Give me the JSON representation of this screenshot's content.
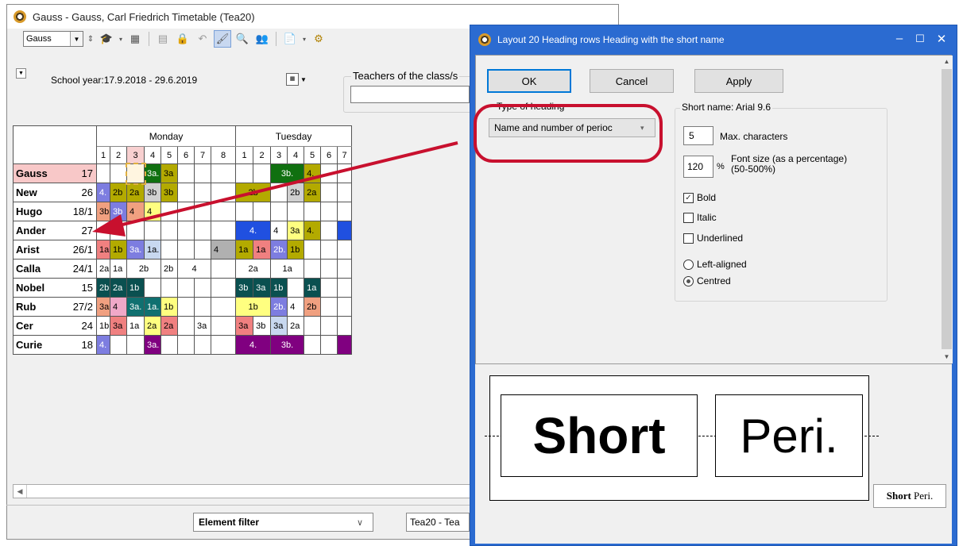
{
  "main_window": {
    "title": "Gauss - Gauss, Carl Friedrich  Timetable  (Tea20)",
    "element_select": "Gauss"
  },
  "info": {
    "school_year": "School year:17.9.2018 - 29.6.2019",
    "teachers_label": "Teachers of the class/s"
  },
  "timetable": {
    "days": [
      "Monday",
      "Tuesday"
    ],
    "periods": [
      "1",
      "2",
      "3",
      "4",
      "5",
      "6",
      "7",
      "8",
      "1",
      "2",
      "3",
      "4",
      "5",
      "6",
      "7"
    ],
    "rows": [
      {
        "name": "Gauss",
        "num": "17",
        "cells": [
          {
            "t": "",
            "s": 1,
            "c": "#ffffff"
          },
          {
            "t": "",
            "s": 1,
            "c": "#ffffff"
          },
          {
            "t": "",
            "s": 1,
            "c": "#fff5e0"
          },
          {
            "t": "3a.",
            "s": 1,
            "c": "#107010",
            "w": true
          },
          {
            "t": "3a",
            "s": 1,
            "c": "#b3aa00"
          },
          {
            "t": "",
            "s": 1,
            "c": "#ffffff"
          },
          {
            "t": "",
            "s": 1,
            "c": "#ffffff"
          },
          {
            "t": "",
            "s": 1,
            "c": "#ffffff"
          },
          {
            "t": "",
            "s": 1,
            "c": "#ffffff"
          },
          {
            "t": "",
            "s": 1,
            "c": "#ffffff"
          },
          {
            "t": "3b.",
            "s": 2,
            "c": "#107010",
            "w": true
          },
          {
            "t": "4.",
            "s": 1,
            "c": "#b3aa00"
          },
          {
            "t": "",
            "s": 1,
            "c": "#ffffff"
          },
          {
            "t": "",
            "s": 1,
            "c": "#ffffff"
          }
        ]
      },
      {
        "name": "New",
        "num": "26",
        "cells": [
          {
            "t": "4.",
            "s": 1,
            "c": "#7d7de0",
            "w": true
          },
          {
            "t": "2b",
            "s": 1,
            "c": "#b3aa00"
          },
          {
            "t": "2a",
            "s": 1,
            "c": "#b3aa00"
          },
          {
            "t": "3b",
            "s": 1,
            "c": "#d0d0d0"
          },
          {
            "t": "3b",
            "s": 1,
            "c": "#b3aa00"
          },
          {
            "t": "",
            "s": 1,
            "c": "#ffffff"
          },
          {
            "t": "",
            "s": 1,
            "c": "#ffffff"
          },
          {
            "t": "",
            "s": 1,
            "c": "#ffffff"
          },
          {
            "t": "2b",
            "s": 2,
            "c": "#b3aa00"
          },
          {
            "t": "",
            "s": 1,
            "c": "#ffffff"
          },
          {
            "t": "2b",
            "s": 1,
            "c": "#d0d0d0"
          },
          {
            "t": "2a",
            "s": 1,
            "c": "#b3aa00"
          },
          {
            "t": "",
            "s": 1,
            "c": "#ffffff"
          },
          {
            "t": "",
            "s": 1,
            "c": "#ffffff"
          }
        ]
      },
      {
        "name": "Hugo",
        "num": "18/1",
        "cells": [
          {
            "t": "3b",
            "s": 1,
            "c": "#f0a080"
          },
          {
            "t": "3b",
            "s": 1,
            "c": "#7d7de0",
            "w": true
          },
          {
            "t": "4",
            "s": 1,
            "c": "#f0a080"
          },
          {
            "t": "4",
            "s": 1,
            "c": "#ffff80"
          },
          {
            "t": "",
            "s": 1,
            "c": "#ffffff"
          },
          {
            "t": "",
            "s": 1,
            "c": "#ffffff"
          },
          {
            "t": "",
            "s": 1,
            "c": "#ffffff"
          },
          {
            "t": "",
            "s": 1,
            "c": "#ffffff"
          },
          {
            "t": "",
            "s": 1,
            "c": "#ffffff"
          },
          {
            "t": "",
            "s": 1,
            "c": "#ffffff"
          },
          {
            "t": "",
            "s": 1,
            "c": "#ffffff"
          },
          {
            "t": "",
            "s": 1,
            "c": "#ffffff"
          },
          {
            "t": "",
            "s": 1,
            "c": "#ffffff"
          },
          {
            "t": "",
            "s": 1,
            "c": "#ffffff"
          },
          {
            "t": "",
            "s": 1,
            "c": "#ffffff"
          }
        ]
      },
      {
        "name": "Ander",
        "num": "27",
        "cells": [
          {
            "t": "",
            "s": 1,
            "c": "#ffffff"
          },
          {
            "t": "",
            "s": 1,
            "c": "#ffffff"
          },
          {
            "t": "",
            "s": 1,
            "c": "#ffffff"
          },
          {
            "t": "",
            "s": 1,
            "c": "#ffffff"
          },
          {
            "t": "",
            "s": 1,
            "c": "#ffffff"
          },
          {
            "t": "",
            "s": 1,
            "c": "#ffffff"
          },
          {
            "t": "",
            "s": 1,
            "c": "#ffffff"
          },
          {
            "t": "",
            "s": 1,
            "c": "#ffffff"
          },
          {
            "t": "4.",
            "s": 2,
            "c": "#2050e0",
            "w": true
          },
          {
            "t": "4",
            "s": 1,
            "c": "#ffffff"
          },
          {
            "t": "3a",
            "s": 1,
            "c": "#ffff80"
          },
          {
            "t": "4.",
            "s": 1,
            "c": "#b3aa00"
          },
          {
            "t": "",
            "s": 1,
            "c": "#ffffff"
          },
          {
            "t": "",
            "s": 1,
            "c": "#2050e0"
          }
        ]
      },
      {
        "name": "Arist",
        "num": "26/1",
        "cells": [
          {
            "t": "1a",
            "s": 1,
            "c": "#f08080"
          },
          {
            "t": "1b",
            "s": 1,
            "c": "#b3aa00"
          },
          {
            "t": "3a.",
            "s": 1,
            "c": "#7d7de0",
            "w": true
          },
          {
            "t": "1a.",
            "s": 1,
            "c": "#c8d8f0"
          },
          {
            "t": "",
            "s": 1,
            "c": "#ffffff"
          },
          {
            "t": "",
            "s": 1,
            "c": "#ffffff"
          },
          {
            "t": "",
            "s": 1,
            "c": "#ffffff"
          },
          {
            "t": "4",
            "s": 1,
            "c": "#b0b0b0"
          },
          {
            "t": "1a",
            "s": 1,
            "c": "#b3aa00"
          },
          {
            "t": "1a",
            "s": 1,
            "c": "#f08080"
          },
          {
            "t": "2b.",
            "s": 1,
            "c": "#7d7de0",
            "w": true
          },
          {
            "t": "1b",
            "s": 1,
            "c": "#b3aa00"
          },
          {
            "t": "",
            "s": 1,
            "c": "#ffffff"
          },
          {
            "t": "",
            "s": 1,
            "c": "#ffffff"
          },
          {
            "t": "",
            "s": 1,
            "c": "#ffffff"
          }
        ]
      },
      {
        "name": "Calla",
        "num": "24/1",
        "cells": [
          {
            "t": "2a",
            "s": 1,
            "c": "#ffffff"
          },
          {
            "t": "1a",
            "s": 1,
            "c": "#ffffff"
          },
          {
            "t": "2b",
            "s": 2,
            "c": "#ffffff"
          },
          {
            "t": "2b",
            "s": 1,
            "c": "#ffffff"
          },
          {
            "t": "4",
            "s": 2,
            "c": "#ffffff"
          },
          {
            "t": "",
            "s": 1,
            "c": "#ffffff"
          },
          {
            "t": "2a",
            "s": 2,
            "c": "#ffffff"
          },
          {
            "t": "1a",
            "s": 2,
            "c": "#ffffff"
          },
          {
            "t": "",
            "s": 1,
            "c": "#ffffff"
          },
          {
            "t": "",
            "s": 1,
            "c": "#ffffff"
          },
          {
            "t": "",
            "s": 1,
            "c": "#ffffff"
          }
        ]
      },
      {
        "name": "Nobel",
        "num": "15",
        "cells": [
          {
            "t": "2b",
            "s": 1,
            "c": "#0a5050",
            "w": true
          },
          {
            "t": "2a",
            "s": 1,
            "c": "#0a5050",
            "w": true
          },
          {
            "t": "1b",
            "s": 1,
            "c": "#0a5050",
            "w": true
          },
          {
            "t": "",
            "s": 1,
            "c": "#ffffff"
          },
          {
            "t": "",
            "s": 1,
            "c": "#ffffff"
          },
          {
            "t": "",
            "s": 1,
            "c": "#ffffff"
          },
          {
            "t": "",
            "s": 1,
            "c": "#ffffff"
          },
          {
            "t": "",
            "s": 1,
            "c": "#ffffff"
          },
          {
            "t": "3b",
            "s": 1,
            "c": "#0a5050",
            "w": true
          },
          {
            "t": "3a",
            "s": 1,
            "c": "#0a5050",
            "w": true
          },
          {
            "t": "1b",
            "s": 1,
            "c": "#0a5050",
            "w": true
          },
          {
            "t": "",
            "s": 1,
            "c": "#ffffff"
          },
          {
            "t": "1a",
            "s": 1,
            "c": "#0a5050",
            "w": true
          },
          {
            "t": "",
            "s": 1,
            "c": "#ffffff"
          },
          {
            "t": "",
            "s": 1,
            "c": "#ffffff"
          }
        ]
      },
      {
        "name": "Rub",
        "num": "27/2",
        "cells": [
          {
            "t": "3a",
            "s": 1,
            "c": "#f0a080"
          },
          {
            "t": "4",
            "s": 1,
            "c": "#f0a8c8"
          },
          {
            "t": "3a.",
            "s": 1,
            "c": "#107070",
            "w": true
          },
          {
            "t": "1a.",
            "s": 1,
            "c": "#107070",
            "w": true
          },
          {
            "t": "1b",
            "s": 1,
            "c": "#ffff80"
          },
          {
            "t": "",
            "s": 1,
            "c": "#ffffff"
          },
          {
            "t": "",
            "s": 1,
            "c": "#ffffff"
          },
          {
            "t": "",
            "s": 1,
            "c": "#ffffff"
          },
          {
            "t": "1b",
            "s": 2,
            "c": "#ffff80"
          },
          {
            "t": "2b.",
            "s": 1,
            "c": "#7d7de0",
            "w": true
          },
          {
            "t": "4",
            "s": 1,
            "c": "#ffffff"
          },
          {
            "t": "2b",
            "s": 1,
            "c": "#f0a080"
          },
          {
            "t": "",
            "s": 1,
            "c": "#ffffff"
          },
          {
            "t": "",
            "s": 1,
            "c": "#ffffff"
          }
        ]
      },
      {
        "name": "Cer",
        "num": "24",
        "cells": [
          {
            "t": "1b",
            "s": 1,
            "c": "#ffffff"
          },
          {
            "t": "3a",
            "s": 1,
            "c": "#f08080"
          },
          {
            "t": "1a",
            "s": 1,
            "c": "#ffffff"
          },
          {
            "t": "2a",
            "s": 1,
            "c": "#ffff80"
          },
          {
            "t": "2a",
            "s": 1,
            "c": "#f08080"
          },
          {
            "t": "",
            "s": 1,
            "c": "#ffffff"
          },
          {
            "t": "3a",
            "s": 1,
            "c": "#ffffff"
          },
          {
            "t": "",
            "s": 1,
            "c": "#ffffff"
          },
          {
            "t": "3a",
            "s": 1,
            "c": "#f08080"
          },
          {
            "t": "3b",
            "s": 1,
            "c": "#ffffff"
          },
          {
            "t": "3a",
            "s": 1,
            "c": "#c8d8f0"
          },
          {
            "t": "2a",
            "s": 1,
            "c": "#ffffff"
          },
          {
            "t": "",
            "s": 1,
            "c": "#ffffff"
          },
          {
            "t": "",
            "s": 1,
            "c": "#ffffff"
          },
          {
            "t": "",
            "s": 1,
            "c": "#ffffff"
          }
        ]
      },
      {
        "name": "Curie",
        "num": "18",
        "cells": [
          {
            "t": "4.",
            "s": 1,
            "c": "#7d7de0",
            "w": true
          },
          {
            "t": "",
            "s": 1,
            "c": "#ffffff"
          },
          {
            "t": "",
            "s": 1,
            "c": "#ffffff"
          },
          {
            "t": "3a.",
            "s": 1,
            "c": "#800080",
            "w": true
          },
          {
            "t": "",
            "s": 1,
            "c": "#ffffff"
          },
          {
            "t": "",
            "s": 1,
            "c": "#ffffff"
          },
          {
            "t": "",
            "s": 1,
            "c": "#ffffff"
          },
          {
            "t": "",
            "s": 1,
            "c": "#ffffff"
          },
          {
            "t": "4.",
            "s": 2,
            "c": "#800080",
            "w": true
          },
          {
            "t": "3b.",
            "s": 2,
            "c": "#800080",
            "w": true
          },
          {
            "t": "",
            "s": 1,
            "c": "#ffffff"
          },
          {
            "t": "",
            "s": 1,
            "c": "#ffffff"
          },
          {
            "t": "",
            "s": 1,
            "c": "#800080"
          }
        ]
      }
    ],
    "name_colors": {
      "Gauss": "#f8c8c8"
    }
  },
  "footer": {
    "element_filter": "Element filter",
    "right_combo": "Tea20 - Tea"
  },
  "dialog": {
    "title": "Layout 20  Heading rows  Heading with the short name",
    "ok": "OK",
    "cancel": "Cancel",
    "apply": "Apply",
    "type_of_heading_label": "Type of heading",
    "type_of_heading_value": "Name and number of perioc",
    "short_name_group": "Short name: Arial 9.6",
    "max_chars_value": "5",
    "max_chars_label": "Max. characters",
    "font_size_value": "120",
    "font_size_unit": "%",
    "font_size_label": "Font size (as a percentage)",
    "font_size_range": "(50-500%)",
    "bold": "Bold",
    "italic": "Italic",
    "underlined": "Underlined",
    "left_aligned": "Left-aligned",
    "centred": "Centred"
  },
  "preview": {
    "big_left": "Short",
    "big_right": "Peri.",
    "small_left": "Short",
    "small_right": "Peri."
  },
  "annotation_color": "#c8102e"
}
